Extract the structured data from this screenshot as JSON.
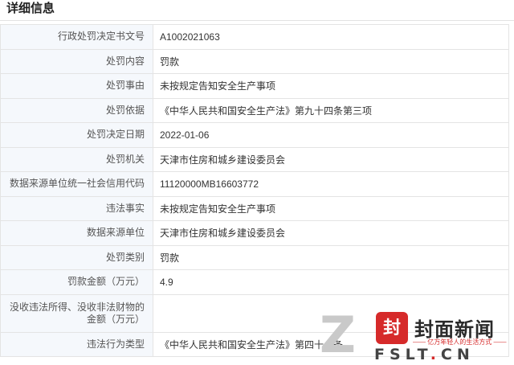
{
  "section": {
    "title": "详细信息"
  },
  "rows": [
    {
      "label": "行政处罚决定书文号",
      "value": "A1002021063"
    },
    {
      "label": "处罚内容",
      "value": "罚款"
    },
    {
      "label": "处罚事由",
      "value": "未按规定告知安全生产事项"
    },
    {
      "label": "处罚依据",
      "value": "《中华人民共和国安全生产法》第九十四条第三项"
    },
    {
      "label": "处罚决定日期",
      "value": "2022-01-06"
    },
    {
      "label": "处罚机关",
      "value": "天津市住房和城乡建设委员会"
    },
    {
      "label": "数据来源单位统一社会信用代码",
      "value": "11120000MB16603772"
    },
    {
      "label": "违法事实",
      "value": "未按规定告知安全生产事项"
    },
    {
      "label": "数据来源单位",
      "value": "天津市住房和城乡建设委员会"
    },
    {
      "label": "处罚类别",
      "value": "罚款"
    },
    {
      "label": "罚款金额（万元）",
      "value": "4.9"
    },
    {
      "label": "没收违法所得、没收非法财物的金额（万元）",
      "value": ""
    },
    {
      "label": "违法行为类型",
      "value": "《中华人民共和国安全生产法》第四十一条"
    }
  ],
  "watermark": {
    "logo_char": "封",
    "name": "封面新闻",
    "slogan": "—— 亿万年轻人的生活方式 ——",
    "domain_part1": "FSLT",
    "domain_dot": ".",
    "domain_part2": "CN",
    "brand_color": "#d62a2a"
  }
}
